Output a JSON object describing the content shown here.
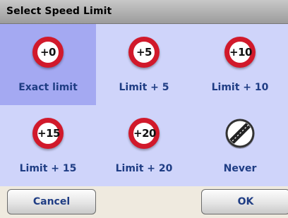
{
  "dialog": {
    "title": "Select Speed Limit"
  },
  "options": [
    {
      "sign_text": "+0",
      "label": "Exact limit",
      "icon": "speed-limit-sign-icon",
      "selected": true
    },
    {
      "sign_text": "+5",
      "label": "Limit + 5",
      "icon": "speed-limit-sign-icon",
      "selected": false
    },
    {
      "sign_text": "+10",
      "label": "Limit + 10",
      "icon": "speed-limit-sign-icon",
      "selected": false
    },
    {
      "sign_text": "+15",
      "label": "Limit + 15",
      "icon": "speed-limit-sign-icon",
      "selected": false
    },
    {
      "sign_text": "+20",
      "label": "Limit + 20",
      "icon": "speed-limit-sign-icon",
      "selected": false
    },
    {
      "sign_text": "",
      "label": "Never",
      "icon": "end-of-limit-sign-icon",
      "selected": false
    }
  ],
  "buttons": {
    "cancel_label": "Cancel",
    "ok_label": "OK"
  },
  "colors": {
    "sign_red": "#d1192b",
    "selected_bg": "#a4a9f2",
    "grid_bg": "#cfd4fa",
    "label_text": "#1f3d84"
  }
}
